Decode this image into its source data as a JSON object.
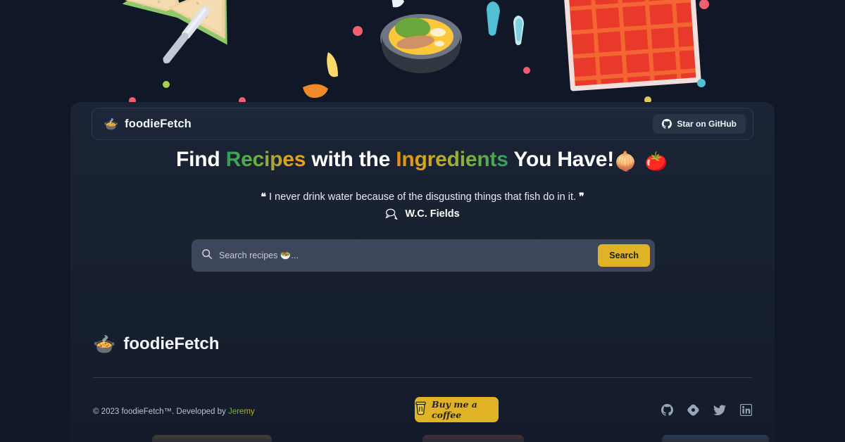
{
  "navbar": {
    "brand_emoji": "🍲",
    "brand_name": "foodieFetch",
    "github_button_label": "Star on GitHub",
    "github_icon": "github-icon"
  },
  "hero": {
    "headline_part1": "Find ",
    "headline_highlight1": "Recipes",
    "headline_part2": " with the ",
    "headline_highlight2": "Ingredients",
    "headline_part3": " You Have!",
    "headline_emojis": "🧅 🍅",
    "quote_open": "❝",
    "quote_text": "I never drink water because of the disgusting things that fish do in it.",
    "quote_close": "❞",
    "quote_author": "W.C. Fields",
    "author_icon": "chat-bubble-icon"
  },
  "search": {
    "placeholder": "Search recipes 🥗...",
    "value": "",
    "button_label": "Search",
    "icon": "search-icon"
  },
  "footer": {
    "logo_emoji": "🍲",
    "logo_text": "foodieFetch",
    "copyright": "© 2023 foodieFetch™. Developed by ",
    "developer": "Jeremy",
    "buy_coffee_label": "Buy me a coffee",
    "buy_coffee_icon": "coffee-cup-icon",
    "socials": [
      {
        "name": "github-icon",
        "label": "GitHub"
      },
      {
        "name": "polywork-icon",
        "label": "Polywork"
      },
      {
        "name": "twitter-icon",
        "label": "Twitter"
      },
      {
        "name": "linkedin-icon",
        "label": "LinkedIn"
      }
    ]
  },
  "colors": {
    "page_background": "#101828",
    "container_background": "#1a2436",
    "accent_yellow": "#e0b327",
    "accent_green": "#2e9e5b",
    "search_field": "#3d465a",
    "text_primary": "#ffffff",
    "text_muted": "#b8c2d1"
  },
  "banner": {
    "description": "food illustration banner",
    "items": [
      "sandwich",
      "knife",
      "pot-of-food",
      "picnic-blanket",
      "water-drops",
      "crumbs"
    ]
  }
}
